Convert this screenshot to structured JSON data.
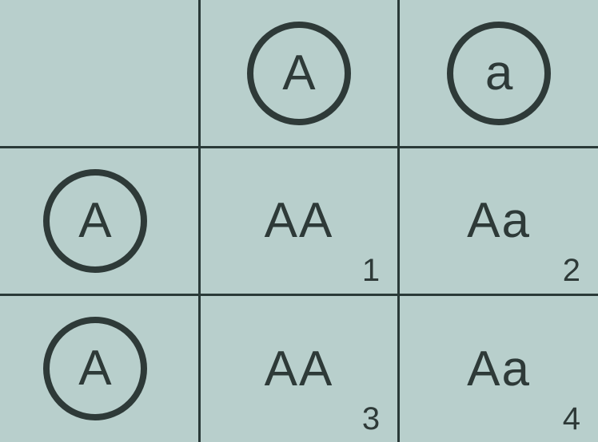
{
  "punnett": {
    "col_headers": [
      "A",
      "a"
    ],
    "row_headers": [
      "A",
      "A"
    ],
    "cells": [
      [
        {
          "genotype": "AA",
          "num": "1"
        },
        {
          "genotype": "Aa",
          "num": "2"
        }
      ],
      [
        {
          "genotype": "AA",
          "num": "3"
        },
        {
          "genotype": "Aa",
          "num": "4"
        }
      ]
    ]
  }
}
